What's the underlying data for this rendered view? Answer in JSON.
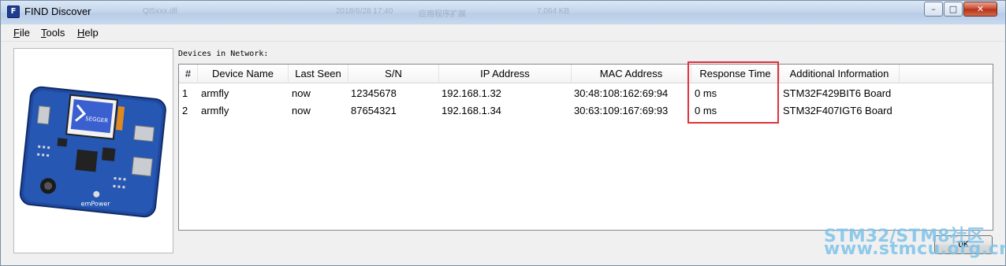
{
  "window": {
    "title": "FIND Discover",
    "app_icon": "F",
    "background_titles": [
      "Qt5xxx.dll",
      "2018/6/28 17:40",
      "应用程序扩展",
      "7,064 KB"
    ],
    "controls": {
      "minimize": "–",
      "maximize": "□",
      "close": "✕"
    }
  },
  "menu": [
    {
      "label": "File",
      "mnemonic": "F",
      "rest": "ile"
    },
    {
      "label": "Tools",
      "mnemonic": "T",
      "rest": "ools"
    },
    {
      "label": "Help",
      "mnemonic": "H",
      "rest": "elp"
    }
  ],
  "board_image": {
    "logo": "SEGGER",
    "caption": "emPower"
  },
  "devices_label": "Devices in Network:",
  "table": {
    "columns": [
      "#",
      "Device Name",
      "Last Seen",
      "S/N",
      "IP Address",
      "MAC Address",
      "Response Time",
      "Additional Information"
    ],
    "rows": [
      [
        "1",
        "armfly",
        "now",
        "12345678",
        "192.168.1.32",
        "30:48:108:162:69:94",
        "0 ms",
        "STM32F429BIT6 Board"
      ],
      [
        "2",
        "armfly",
        "now",
        "87654321",
        "192.168.1.34",
        "30:63:109:167:69:93",
        "0 ms",
        "STM32F407IGT6 Board"
      ]
    ]
  },
  "ok_label": "OK",
  "watermark": {
    "line1": "STM32/STM8社区",
    "line2": "www.stmcu.org.cn"
  },
  "colors": {
    "highlight": "#e0313a",
    "watermark": "#7ec3ea",
    "board": "#1f4aa0"
  }
}
